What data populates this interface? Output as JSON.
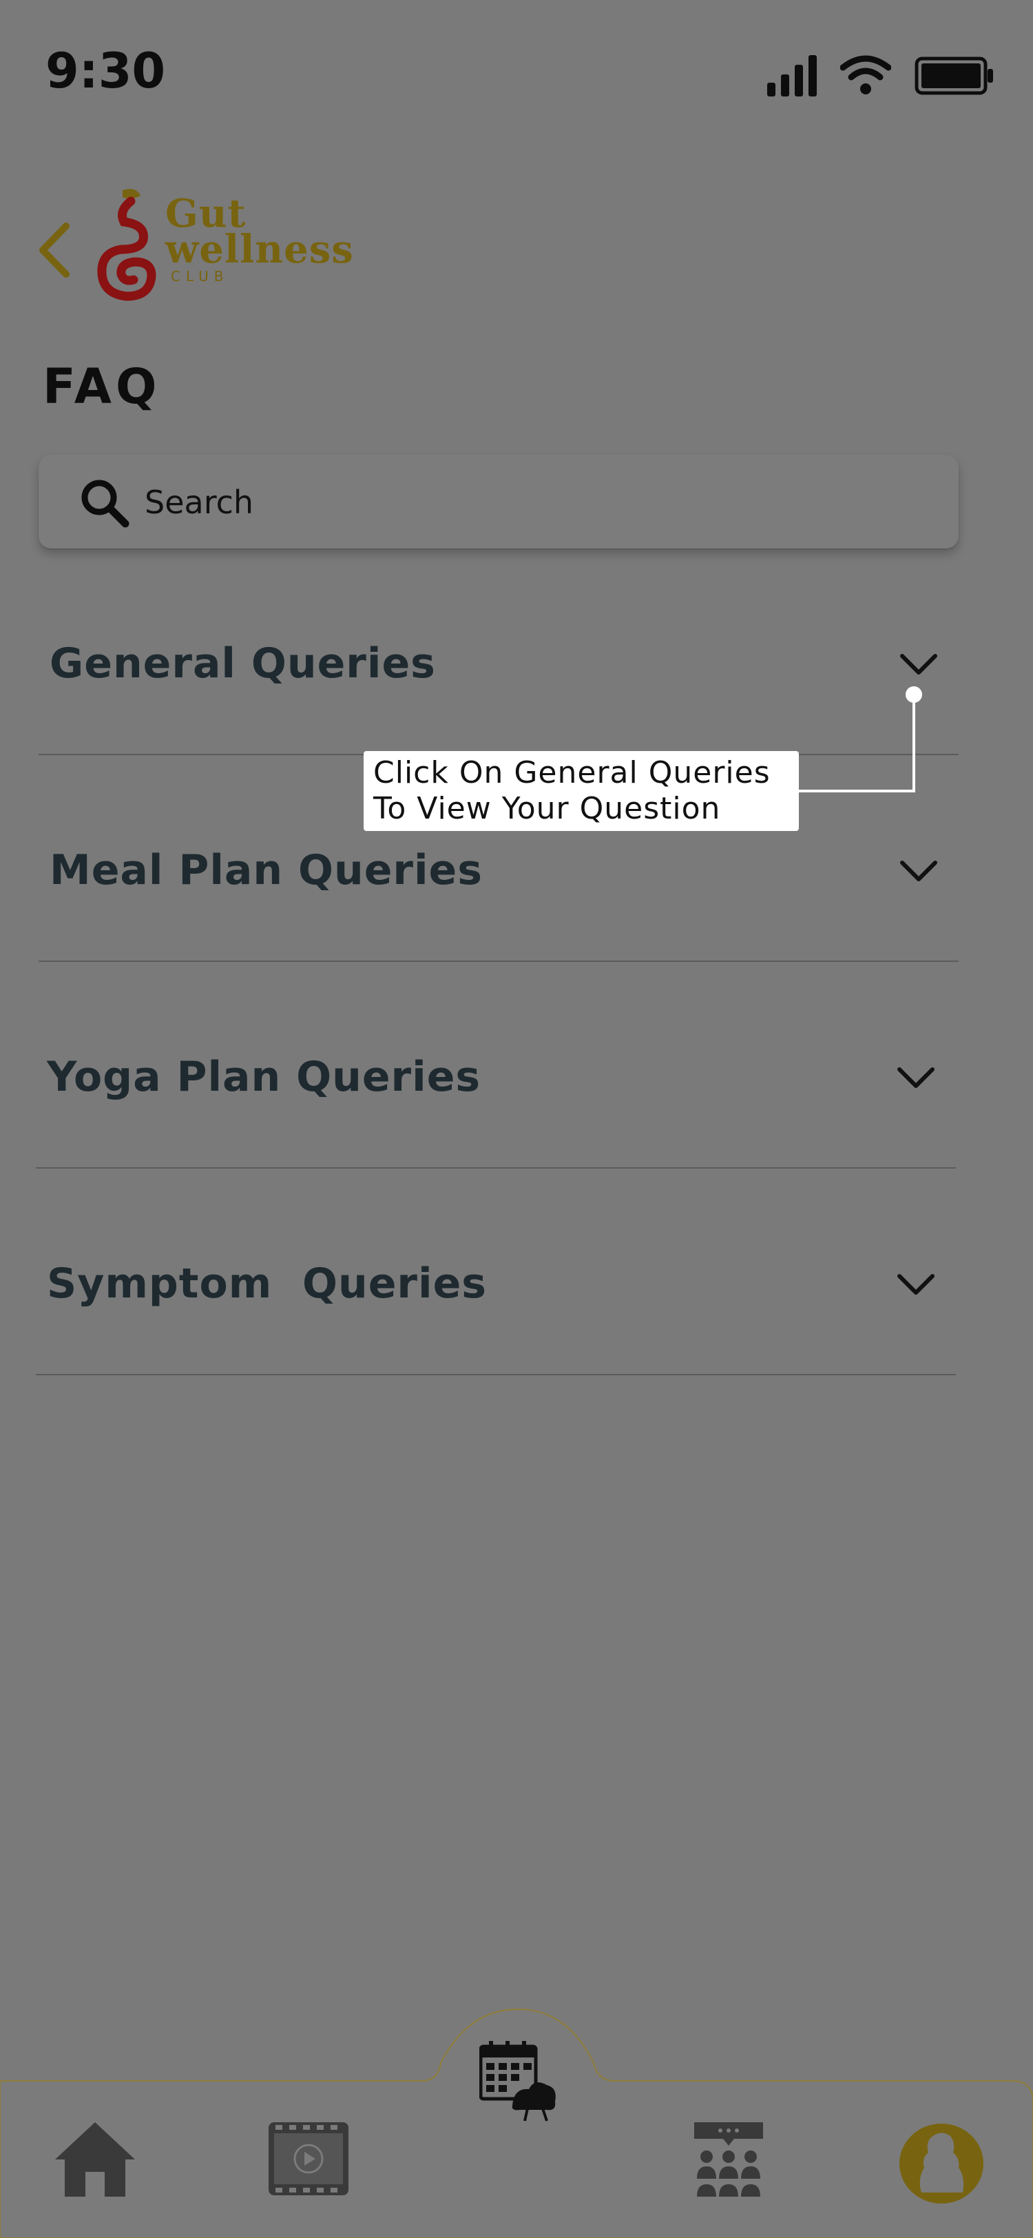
{
  "status_bar": {
    "time": "9:30"
  },
  "header": {
    "logo_line1": "Gut",
    "logo_line2": "wellness",
    "logo_line3": "CLUB",
    "title": "FAQ"
  },
  "search": {
    "placeholder": "Search"
  },
  "faq": [
    {
      "label": "General Queries"
    },
    {
      "label": "Meal Plan Queries"
    },
    {
      "label": "Yoga Plan Queries"
    },
    {
      "label": "Symptom  Queries"
    }
  ],
  "tooltip": {
    "line1": "Click On General Queries",
    "line2": "To View Your Question"
  },
  "bottom_nav": {
    "items": [
      "home-icon",
      "video-icon",
      "calendar-schedule-icon",
      "community-icon",
      "profile-avatar"
    ]
  },
  "colors": {
    "overlay_bg": "#7a7a7a",
    "brand_gold": "#786410",
    "brand_red": "#8a1212",
    "text_dark": "#1e2a30"
  }
}
